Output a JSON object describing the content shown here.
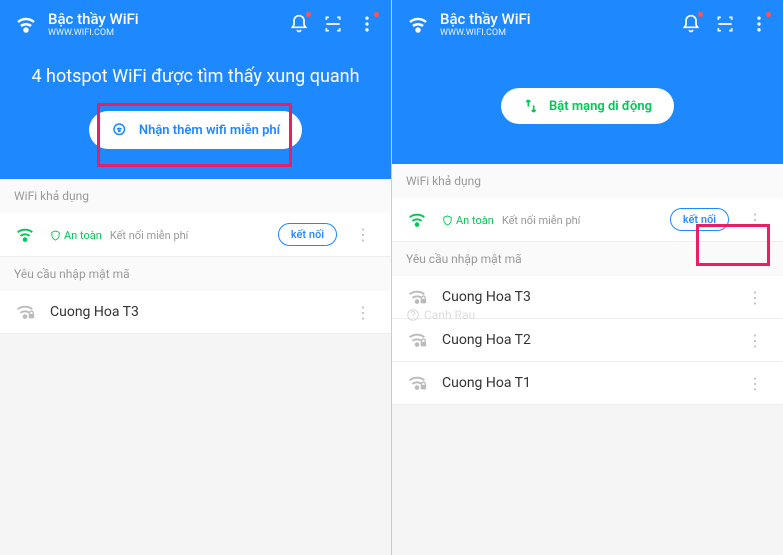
{
  "header": {
    "title": "Bậc thầy WiFi",
    "subtitle": "WWW.WIFI.COM"
  },
  "left": {
    "hero_text": "4 hotspot WiFi được tìm thấy xung quanh",
    "hero_button": "Nhận thêm wifi miễn phí",
    "section_available": "WiFi khả dụng",
    "safe_label": "An toàn",
    "free_label": "Kết nối miễn phí",
    "connect": "kết nối",
    "section_password": "Yêu cầu nhập mật mã",
    "password_networks": [
      {
        "name": "Cuong Hoa T3"
      }
    ]
  },
  "right": {
    "hero_button": "Bật mạng di động",
    "section_available": "WiFi khả dụng",
    "safe_label": "An toàn",
    "free_label": "Kết nối miễn phí",
    "connect": "kết nối",
    "section_password": "Yêu cầu nhập mật mã",
    "watermark": "Canh Rau",
    "password_networks": [
      {
        "name": "Cuong Hoa T3"
      },
      {
        "name": "Cuong Hoa T2"
      },
      {
        "name": "Cuong Hoa T1"
      }
    ]
  }
}
